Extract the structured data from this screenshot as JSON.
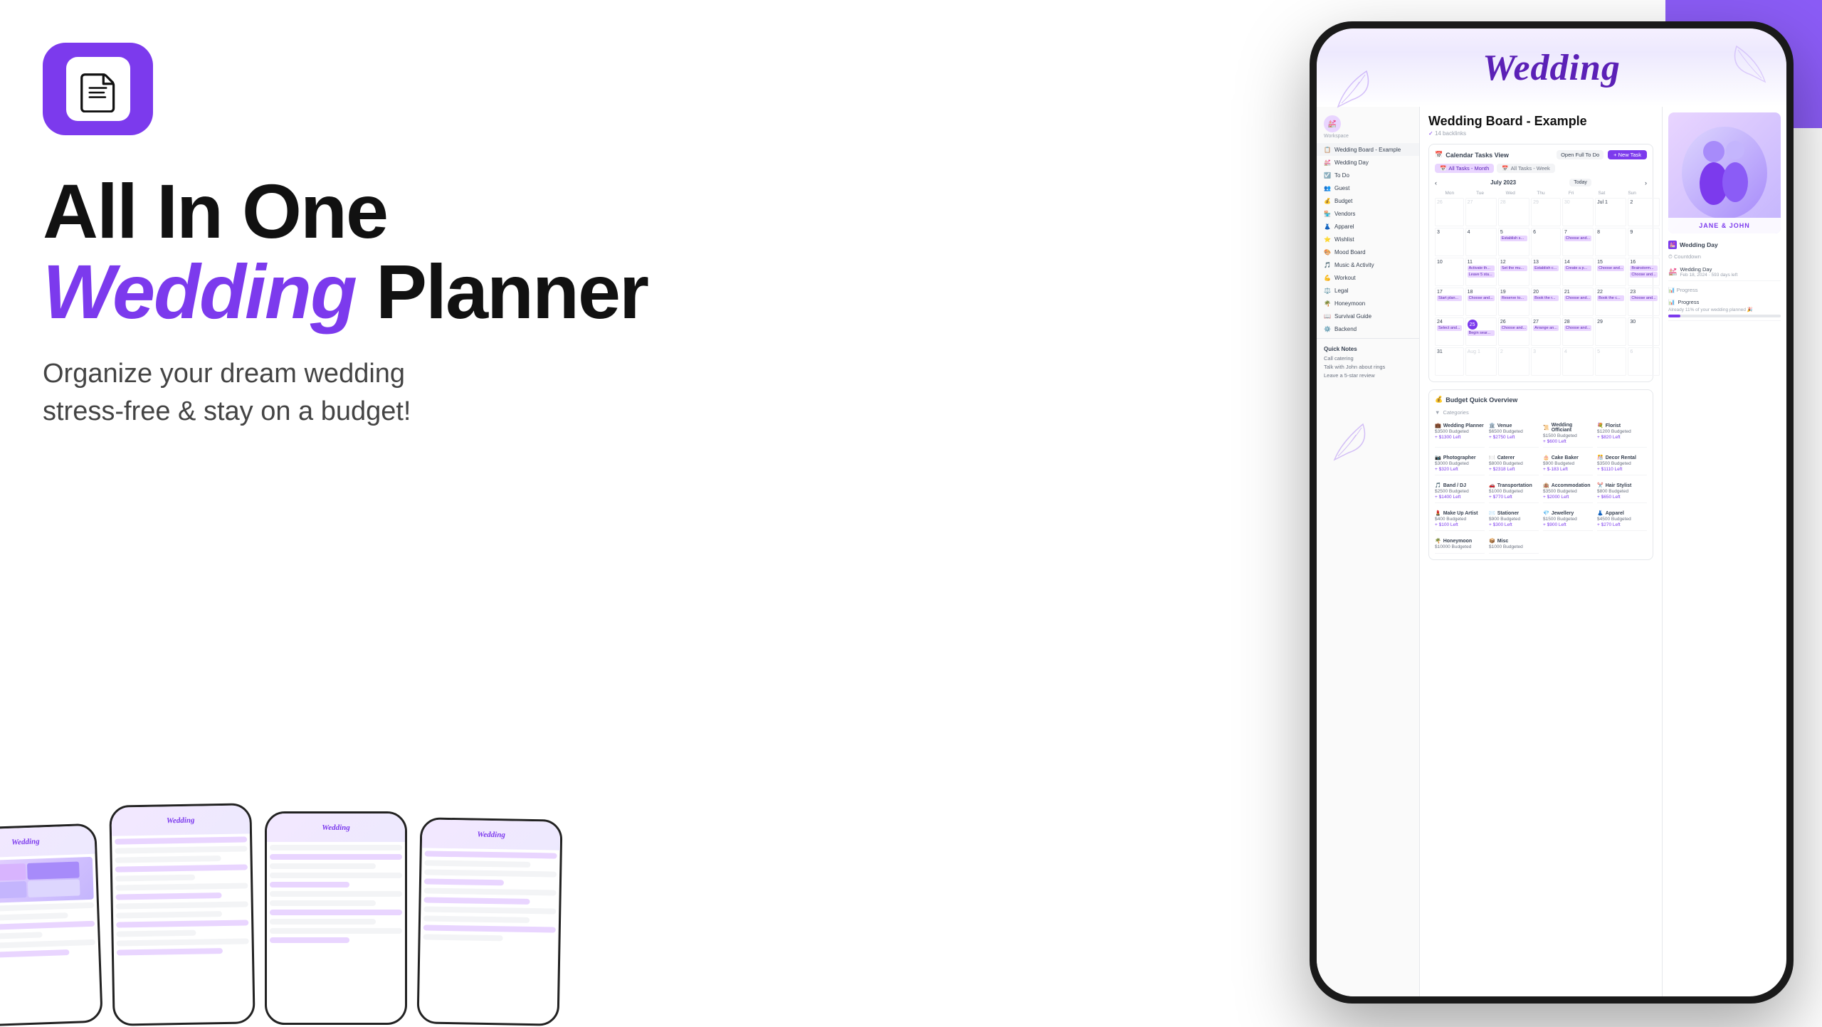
{
  "app": {
    "title": "All In One Wedding Planner"
  },
  "header": {
    "notion_badge_alt": "Notion Logo"
  },
  "hero": {
    "line1": "All In One",
    "line2_wedding": "Wedding",
    "line2_planner": " Planner",
    "subheadline_line1": "Organize your dream wedding",
    "subheadline_line2": "stress-free & stay on a budget!"
  },
  "phone": {
    "wedding_title": "Wedding",
    "page_title": "Wedding Board - Example",
    "page_meta": "14 backlinks",
    "couple_names": "JANE & JOHN"
  },
  "sidebar": {
    "items": [
      {
        "label": "Wedding Board - Example",
        "icon": "📋",
        "active": true
      },
      {
        "label": "Wedding Day",
        "icon": "💒"
      },
      {
        "label": "To Do",
        "icon": "✅"
      },
      {
        "label": "Guest",
        "icon": "👥"
      },
      {
        "label": "Budget",
        "icon": "💰"
      },
      {
        "label": "Vendors",
        "icon": "🏪"
      },
      {
        "label": "Apparel",
        "icon": "👗"
      },
      {
        "label": "Wishlist",
        "icon": "⭐"
      },
      {
        "label": "Mood Board",
        "icon": "🎨"
      },
      {
        "label": "Music & Activity",
        "icon": "🎵"
      },
      {
        "label": "Workout",
        "icon": "💪"
      },
      {
        "label": "Legal",
        "icon": "⚖️"
      },
      {
        "label": "Honeymoon",
        "icon": "🌴"
      },
      {
        "label": "Survival Guide",
        "icon": "📖"
      },
      {
        "label": "Backend",
        "icon": "⚙️"
      }
    ]
  },
  "calendar": {
    "title": "Calendar Tasks View",
    "open_full": "Open Full To Do",
    "new_task": "+ New Task",
    "tab_all_month": "All Tasks - Month",
    "tab_all_week": "All Tasks - Week",
    "month_label": "July 2023",
    "today_btn": "Today",
    "day_headers": [
      "Mon",
      "Tue",
      "Wed",
      "Thu",
      "Fri",
      "Sat",
      "Sun"
    ],
    "weeks": [
      [
        {
          "num": "26",
          "other": true,
          "events": []
        },
        {
          "num": "27",
          "other": true,
          "events": []
        },
        {
          "num": "28",
          "other": true,
          "events": []
        },
        {
          "num": "29",
          "other": true,
          "events": []
        },
        {
          "num": "30",
          "other": true,
          "events": []
        },
        {
          "num": "Jul 1",
          "events": []
        },
        {
          "num": "2",
          "events": []
        }
      ],
      [
        {
          "num": "3",
          "events": []
        },
        {
          "num": "4",
          "events": []
        },
        {
          "num": "5",
          "events": [
            "Establish s..."
          ]
        },
        {
          "num": "6",
          "events": []
        },
        {
          "num": "7",
          "events": [
            "Choose and..."
          ]
        },
        {
          "num": "8",
          "events": []
        },
        {
          "num": "9",
          "events": []
        }
      ],
      [
        {
          "num": "10",
          "events": []
        },
        {
          "num": "11",
          "events": [
            "Activate th...",
            "Leave 5 sta..."
          ]
        },
        {
          "num": "12",
          "events": [
            "Set the mu..."
          ]
        },
        {
          "num": "13",
          "events": [
            "Establish c..."
          ]
        },
        {
          "num": "14",
          "events": [
            "Create a p..."
          ]
        },
        {
          "num": "15",
          "events": [
            "Choose and..."
          ]
        },
        {
          "num": "16",
          "events": [
            "Brainstorm...",
            "Choose and..."
          ]
        }
      ],
      [
        {
          "num": "17",
          "events": [
            "Start plan..."
          ]
        },
        {
          "num": "18",
          "events": [
            "Choose and..."
          ]
        },
        {
          "num": "19",
          "events": [
            "Reserve to..."
          ]
        },
        {
          "num": "20",
          "events": [
            "Book the r..."
          ]
        },
        {
          "num": "21",
          "events": [
            "Choose and..."
          ]
        },
        {
          "num": "22",
          "events": [
            "Book the c..."
          ]
        },
        {
          "num": "23",
          "events": [
            "Choose and..."
          ]
        }
      ],
      [
        {
          "num": "24",
          "events": [
            "Select and..."
          ]
        },
        {
          "num": "25",
          "today": true,
          "events": [
            "Begin sear..."
          ]
        },
        {
          "num": "26",
          "events": [
            "Choose and..."
          ]
        },
        {
          "num": "27",
          "events": [
            "Arrange an..."
          ]
        },
        {
          "num": "28",
          "events": [
            "Choose and..."
          ]
        },
        {
          "num": "29",
          "events": []
        },
        {
          "num": "30",
          "events": []
        }
      ],
      [
        {
          "num": "31",
          "events": []
        },
        {
          "num": "Aug 1",
          "other": true,
          "events": []
        },
        {
          "num": "2",
          "other": true,
          "events": []
        },
        {
          "num": "3",
          "other": true,
          "events": []
        },
        {
          "num": "4",
          "other": true,
          "events": []
        },
        {
          "num": "5",
          "other": true,
          "events": []
        },
        {
          "num": "6",
          "other": true,
          "events": []
        }
      ]
    ]
  },
  "wedding_day_panel": {
    "section_title": "Wedding Day",
    "countdown_section": "Countdown",
    "countdown_items": [
      {
        "label": "Wedding Day",
        "sub": "Feb 18, 2024 · 593 days left"
      }
    ],
    "progress_section": "Progress",
    "progress_items": [
      {
        "label": "Progress",
        "desc": "Already 11% of your wedding planned 🎉",
        "percent": 11
      }
    ]
  },
  "budget": {
    "title": "Budget Quick Overview",
    "categories_label": "Categories",
    "items": [
      {
        "name": "Wedding Planner",
        "icon": "💼",
        "budget": "$3500 Budgeted",
        "left": "+ $1300 Left"
      },
      {
        "name": "Venue",
        "icon": "🏛️",
        "budget": "$6500 Budgeted",
        "left": "+ $2750 Left"
      },
      {
        "name": "Wedding Officiant",
        "icon": "📜",
        "budget": "$1500 Budgeted",
        "left": "+ $600 Left"
      },
      {
        "name": "Florist",
        "icon": "💐",
        "budget": "$1200 Budgeted",
        "left": "+ $820 Left"
      },
      {
        "name": "Photographer",
        "icon": "📷",
        "budget": "$3000 Budgeted",
        "left": "+ $320 Left"
      },
      {
        "name": "Caterer",
        "icon": "🍽️",
        "budget": "$8000 Budgeted",
        "left": "+ $2318 Left"
      },
      {
        "name": "Cake Baker",
        "icon": "🎂",
        "budget": "$900 Budgeted",
        "left": "+ $-183 Left"
      },
      {
        "name": "Decor Rental",
        "icon": "🎊",
        "budget": "$3500 Budgeted",
        "left": "+ $1110 Left"
      },
      {
        "name": "Band / DJ",
        "icon": "🎵",
        "budget": "$2500 Budgeted",
        "left": "+ $1400 Left"
      },
      {
        "name": "Transportation",
        "icon": "🚗",
        "budget": "$1000 Budgeted",
        "left": "+ $770 Left"
      },
      {
        "name": "Accommodation",
        "icon": "🏨",
        "budget": "$3500 Budgeted",
        "left": "+ $2000 Left"
      },
      {
        "name": "Hair Stylist",
        "icon": "✂️",
        "budget": "$800 Budgeted",
        "left": "+ $650 Left"
      },
      {
        "name": "Make Up Artist",
        "icon": "💄",
        "budget": "$400 Budgeted",
        "left": "+ $100 Left"
      },
      {
        "name": "Stationer",
        "icon": "✉️",
        "budget": "$900 Budgeted",
        "left": "+ $300 Left"
      },
      {
        "name": "Jewellery",
        "icon": "💎",
        "budget": "$1500 Budgeted",
        "left": "+ $900 Left"
      },
      {
        "name": "Apparel",
        "icon": "👗",
        "budget": "$4500 Budgeted",
        "left": "+ $270 Left"
      },
      {
        "name": "Honeymoon",
        "icon": "🌴",
        "budget": "$10000 Budgeted",
        "left": ""
      },
      {
        "name": "Misc",
        "icon": "📦",
        "budget": "$1000 Budgeted",
        "left": ""
      }
    ]
  },
  "quick_notes": {
    "title": "Quick Notes",
    "items": [
      "Call catering",
      "Talk with John about rings",
      "Leave a 5-star review"
    ]
  },
  "device_previews": [
    {
      "title": "Wedding",
      "rows": [
        {
          "type": "image",
          "color": "#d8b4fe"
        },
        {
          "type": "text",
          "len": "full"
        },
        {
          "type": "text",
          "len": "medium"
        },
        {
          "type": "image2",
          "color": "#c4b5fd"
        },
        {
          "type": "text",
          "len": "full"
        },
        {
          "type": "text",
          "len": "short"
        }
      ]
    },
    {
      "title": "Wedding",
      "rows": [
        {
          "type": "text",
          "len": "full"
        },
        {
          "type": "text",
          "len": "full"
        },
        {
          "type": "text",
          "len": "medium"
        },
        {
          "type": "text",
          "len": "full"
        },
        {
          "type": "text",
          "len": "short"
        },
        {
          "type": "text",
          "len": "full"
        },
        {
          "type": "text",
          "len": "medium"
        },
        {
          "type": "text",
          "len": "full"
        }
      ]
    },
    {
      "title": "Wedding",
      "rows": [
        {
          "type": "text",
          "len": "full"
        },
        {
          "type": "text",
          "len": "full"
        },
        {
          "type": "text",
          "len": "medium"
        },
        {
          "type": "text",
          "len": "full"
        },
        {
          "type": "text",
          "len": "short"
        },
        {
          "type": "text",
          "len": "full"
        }
      ]
    },
    {
      "title": "Wedding",
      "rows": [
        {
          "type": "text",
          "len": "full"
        },
        {
          "type": "text",
          "len": "medium"
        },
        {
          "type": "text",
          "len": "full"
        },
        {
          "type": "text",
          "len": "short"
        },
        {
          "type": "text",
          "len": "full"
        },
        {
          "type": "text",
          "len": "medium"
        }
      ]
    }
  ]
}
